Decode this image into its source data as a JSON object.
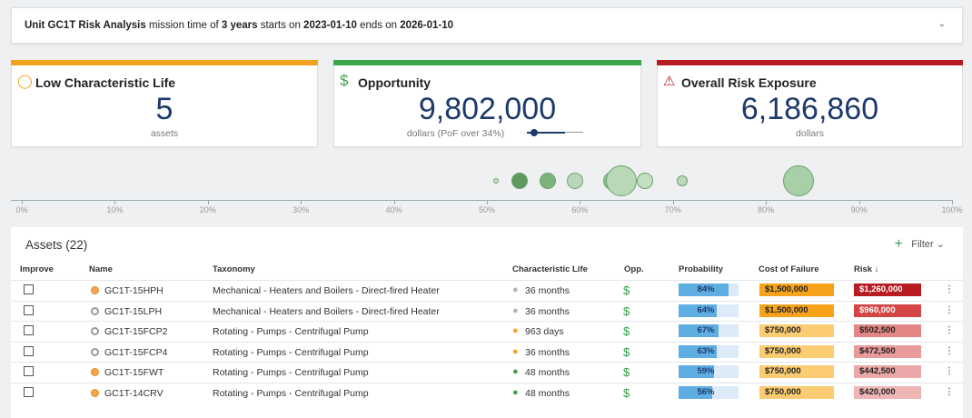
{
  "header": {
    "unit": "Unit GC1T Risk Analysis",
    "t1": "mission time of",
    "years": "3 years",
    "t2": "starts on",
    "start": "2023-01-10",
    "t3": "ends on",
    "end": "2026-01-10"
  },
  "cards": [
    {
      "title": "Low Characteristic Life",
      "value": "5",
      "sub": "assets",
      "color": "#f1a21c"
    },
    {
      "title": "Opportunity",
      "value": "9,802,000",
      "sub": "dollars (PoF over 34%)",
      "color": "#3ea64a"
    },
    {
      "title": "Overall Risk Exposure",
      "value": "6,186,860",
      "sub": "dollars",
      "color": "#b81c22"
    }
  ],
  "opportunity_slider_fraction": 0.14,
  "axis_ticks": [
    "0%",
    "10%",
    "20%",
    "30%",
    "40%",
    "50%",
    "60%",
    "70%",
    "80%",
    "90%",
    "100%"
  ],
  "bubbles": [
    {
      "pct": 51.0,
      "r": 3,
      "fill": "#c9e3c9"
    },
    {
      "pct": 53.5,
      "r": 9,
      "fill": "#5e9a60"
    },
    {
      "pct": 56.5,
      "r": 9,
      "fill": "#7cb37c"
    },
    {
      "pct": 59.5,
      "r": 9,
      "fill": "#b8d8b8"
    },
    {
      "pct": 63.5,
      "r": 10,
      "fill": "#8ebf8e"
    },
    {
      "pct": 64.5,
      "r": 17,
      "fill": "#b8d8b8"
    },
    {
      "pct": 67.0,
      "r": 9,
      "fill": "#c4dfc4"
    },
    {
      "pct": 71.0,
      "r": 6,
      "fill": "#b8d8b8"
    },
    {
      "pct": 83.5,
      "r": 17,
      "fill": "#a8d0a8"
    }
  ],
  "table": {
    "title": "Assets (22)",
    "filter_label": "Filter",
    "columns": [
      "Improve",
      "Name",
      "Taxonomy",
      "Characteristic Life",
      "Opp.",
      "Probability",
      "Cost of Failure",
      "Risk ↓"
    ],
    "rows": [
      {
        "name": "GC1T-15HPH",
        "status": "orange",
        "taxonomy": "Mechanical - Heaters and Boilers - Direct-fired Heater",
        "life": "36 months",
        "pin": "grey",
        "prob": 84,
        "cof": "$1,500,000",
        "cof_color": "#f7a21b",
        "risk": "$1,260,000",
        "risk_color": "#b81c22",
        "risk_text": "#fff"
      },
      {
        "name": "GC1T-15LPH",
        "status": "grey",
        "taxonomy": "Mechanical - Heaters and Boilers - Direct-fired Heater",
        "life": "36 months",
        "pin": "grey",
        "prob": 64,
        "cof": "$1,500,000",
        "cof_color": "#f7a21b",
        "risk": "$960,000",
        "risk_color": "#d44545",
        "risk_text": "#fff"
      },
      {
        "name": "GC1T-15FCP2",
        "status": "grey",
        "taxonomy": "Rotating - Pumps - Centrifugal Pump",
        "life": "963 days",
        "pin": "orange",
        "prob": 67,
        "cof": "$750,000",
        "cof_color": "#fbcc72",
        "risk": "$502,500",
        "risk_color": "#e58686",
        "risk_text": "#222"
      },
      {
        "name": "GC1T-15FCP4",
        "status": "grey",
        "taxonomy": "Rotating - Pumps - Centrifugal Pump",
        "life": "36 months",
        "pin": "orange",
        "prob": 63,
        "cof": "$750,000",
        "cof_color": "#fbcc72",
        "risk": "$472,500",
        "risk_color": "#e99a9a",
        "risk_text": "#222"
      },
      {
        "name": "GC1T-15FWT",
        "status": "orange",
        "taxonomy": "Rotating - Pumps - Centrifugal Pump",
        "life": "48 months",
        "pin": "green",
        "prob": 59,
        "cof": "$750,000",
        "cof_color": "#fbcc72",
        "risk": "$442,500",
        "risk_color": "#eba8a8",
        "risk_text": "#222"
      },
      {
        "name": "GC1T-14CRV",
        "status": "orange",
        "taxonomy": "Rotating - Pumps - Centrifugal Pump",
        "life": "48 months",
        "pin": "green",
        "prob": 56,
        "cof": "$750,000",
        "cof_color": "#fbcc72",
        "risk": "$420,000",
        "risk_color": "#efb6b6",
        "risk_text": "#222"
      }
    ]
  }
}
